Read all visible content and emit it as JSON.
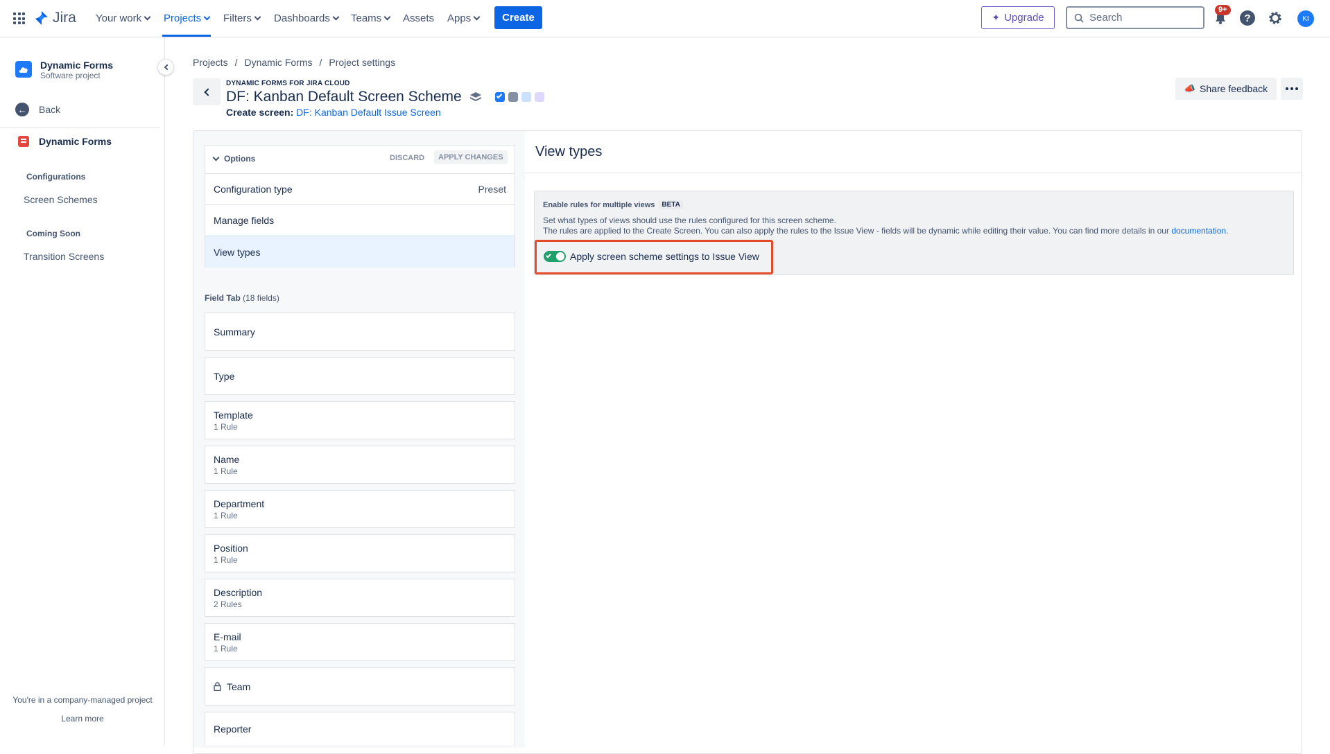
{
  "topbar": {
    "app_name": "Jira",
    "nav": {
      "your_work": "Your work",
      "projects": "Projects",
      "filters": "Filters",
      "dashboards": "Dashboards",
      "teams": "Teams",
      "assets": "Assets",
      "apps": "Apps"
    },
    "create_label": "Create",
    "upgrade_label": "Upgrade",
    "search_placeholder": "Search",
    "notifications_badge": "9+",
    "avatar_initials": "KI"
  },
  "sidebar": {
    "project_name": "Dynamic Forms",
    "project_type": "Software project",
    "back_label": "Back",
    "app_name": "Dynamic Forms",
    "section_configurations": "Configurations",
    "item_screen_schemes": "Screen Schemes",
    "section_coming_soon": "Coming Soon",
    "item_transition_screens": "Transition Screens",
    "footer_text": "You're in a company-managed project",
    "learn_more": "Learn more"
  },
  "breadcrumb": [
    "Projects",
    "Dynamic Forms",
    "Project settings"
  ],
  "header": {
    "app_tag": "DYNAMIC FORMS FOR JIRA CLOUD",
    "title": "DF: Kanban Default Screen Scheme",
    "create_screen_label": "Create screen:",
    "create_screen_link": "DF: Kanban Default Issue Screen",
    "share_feedback": "Share feedback"
  },
  "options": {
    "header": "Options",
    "discard": "DISCARD",
    "apply": "APPLY CHANGES",
    "rows": {
      "config_type": "Configuration type",
      "config_value": "Preset",
      "manage_fields": "Manage fields",
      "view_types": "View types"
    }
  },
  "field_tab": {
    "label": "Field Tab",
    "count": "(18 fields)",
    "fields": [
      {
        "name": "Summary",
        "rule": ""
      },
      {
        "name": "Type",
        "rule": ""
      },
      {
        "name": "Template",
        "rule": "1 Rule"
      },
      {
        "name": "Name",
        "rule": "1 Rule"
      },
      {
        "name": "Department",
        "rule": "1 Rule"
      },
      {
        "name": "Position",
        "rule": "1 Rule"
      },
      {
        "name": "Description",
        "rule": "2 Rules"
      },
      {
        "name": "E-mail",
        "rule": "1 Rule"
      },
      {
        "name": "Team",
        "rule": ""
      },
      {
        "name": "Reporter",
        "rule": ""
      }
    ]
  },
  "view_types": {
    "title": "View types",
    "box_heading": "Enable rules for multiple views",
    "beta": "BETA",
    "line1": "Set what types of views should use the rules configured for this screen scheme.",
    "line2": "The rules are applied to the Create Screen. You can also apply the rules to the Issue View - fields will be dynamic while editing their value. You can find more details in our",
    "link": "documentation",
    "toggle_label": "Apply screen scheme settings to Issue View"
  },
  "colors": {
    "brand": "#0c66e4",
    "toggle_on": "#22a06b",
    "highlight": "#e34b2b"
  }
}
